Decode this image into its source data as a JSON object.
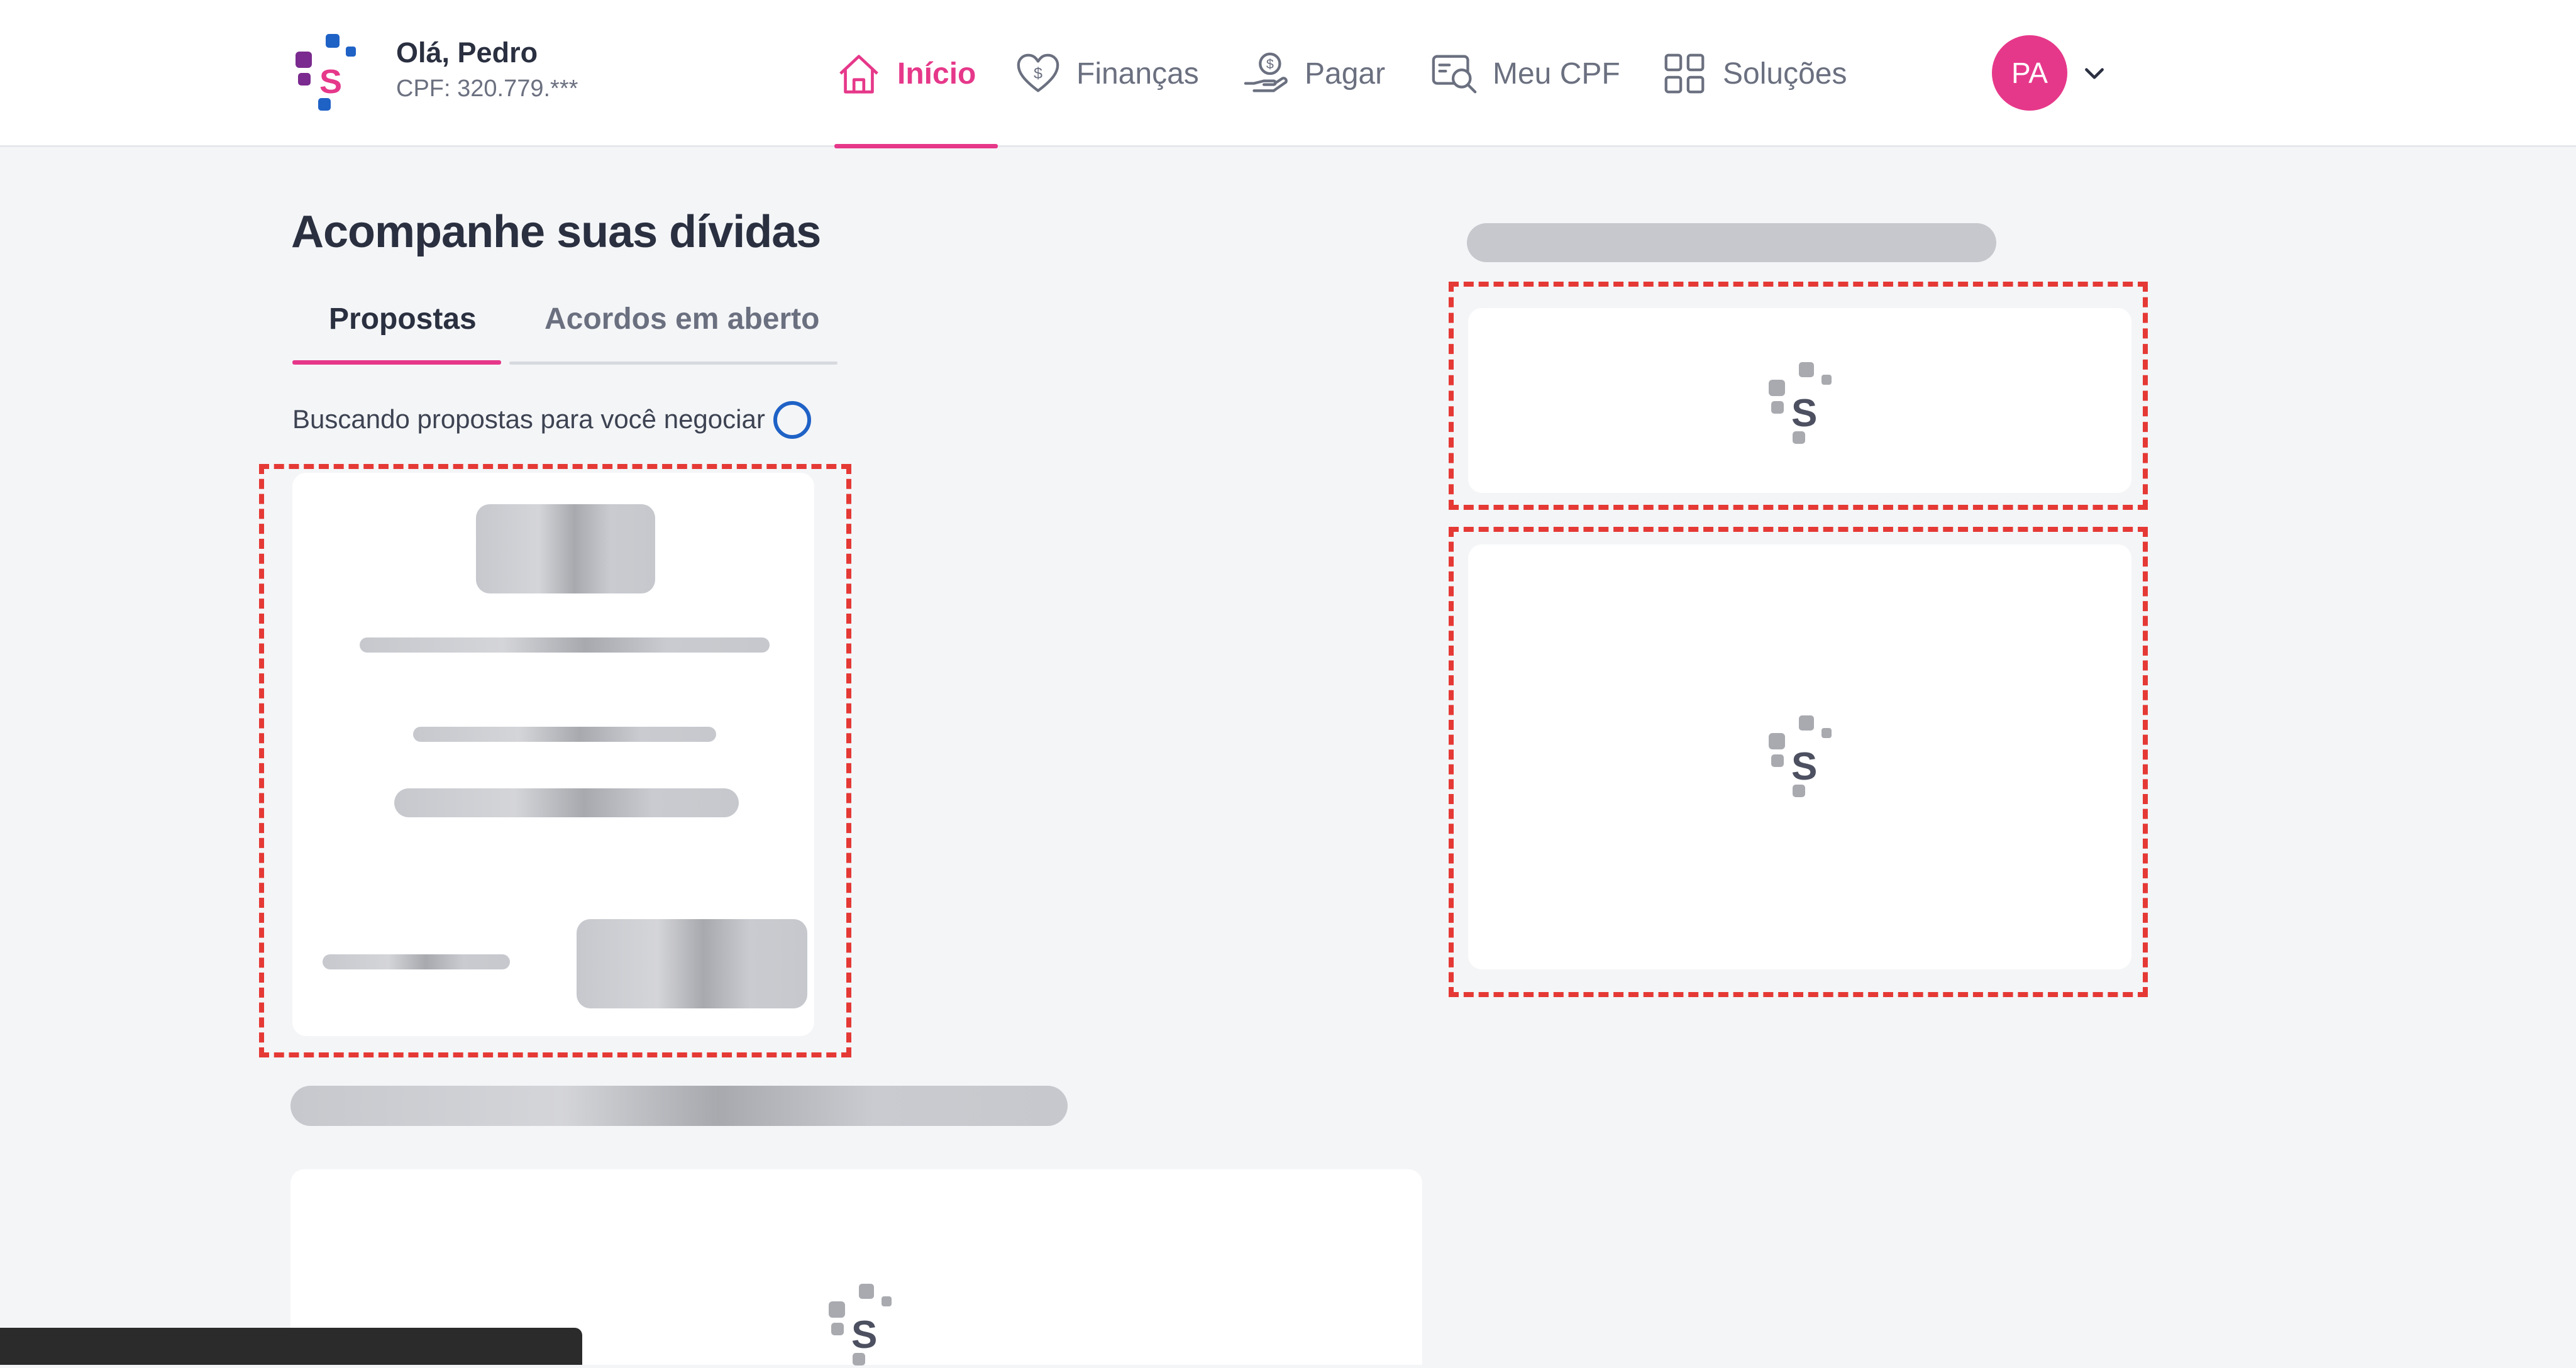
{
  "header": {
    "greeting": "Olá, Pedro",
    "cpf": "CPF: 320.779.***",
    "nav": [
      {
        "label": "Início",
        "icon": "home-icon",
        "active": true
      },
      {
        "label": "Finanças",
        "icon": "heart-dollar-icon",
        "active": false
      },
      {
        "label": "Pagar",
        "icon": "hand-coin-icon",
        "active": false
      },
      {
        "label": "Meu CPF",
        "icon": "id-search-icon",
        "active": false
      },
      {
        "label": "Soluções",
        "icon": "grid-icon",
        "active": false
      }
    ],
    "avatar_initials": "PA"
  },
  "main": {
    "title": "Acompanhe suas dívidas",
    "tabs": [
      {
        "label": "Propostas",
        "active": true
      },
      {
        "label": "Acordos em aberto",
        "active": false
      }
    ],
    "status_text": "Buscando propostas para você negociar"
  },
  "colors": {
    "accent": "#e6388a",
    "spinner": "#1f62c6",
    "highlight_dashes": "#e53935",
    "background": "#f4f5f7"
  }
}
